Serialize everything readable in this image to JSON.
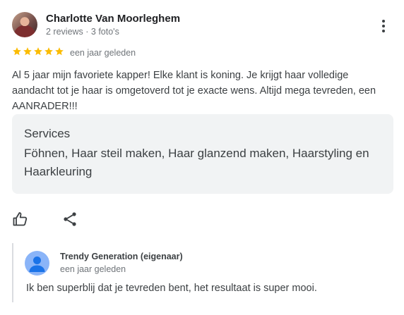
{
  "author": {
    "name": "Charlotte Van Moorleghem",
    "meta": "2 reviews · 3 foto's"
  },
  "review": {
    "rating": 5,
    "date": "een jaar geleden",
    "text": "Al 5 jaar mijn favoriete kapper! Elke klant is koning. Je krijgt haar volledige aandacht tot je haar is omgetoverd tot je exacte wens. Altijd mega tevreden, een AANRADER!!!"
  },
  "services": {
    "title": "Services",
    "list": "Föhnen, Haar steil maken, Haar glanzend maken, Haarstyling en Haarkleuring"
  },
  "owner_reply": {
    "name": "Trendy Generation (eigenaar)",
    "date": "een jaar geleden",
    "text": "Ik ben superblij dat je tevreden bent, het resultaat is super mooi."
  },
  "colors": {
    "star": "#fbbc04",
    "services_bg": "#f1f3f4",
    "owner_avatar": "#8ab4f8"
  },
  "icons": [
    "more-vert-icon",
    "star-icon",
    "thumb-up-icon",
    "share-icon",
    "person-icon"
  ]
}
